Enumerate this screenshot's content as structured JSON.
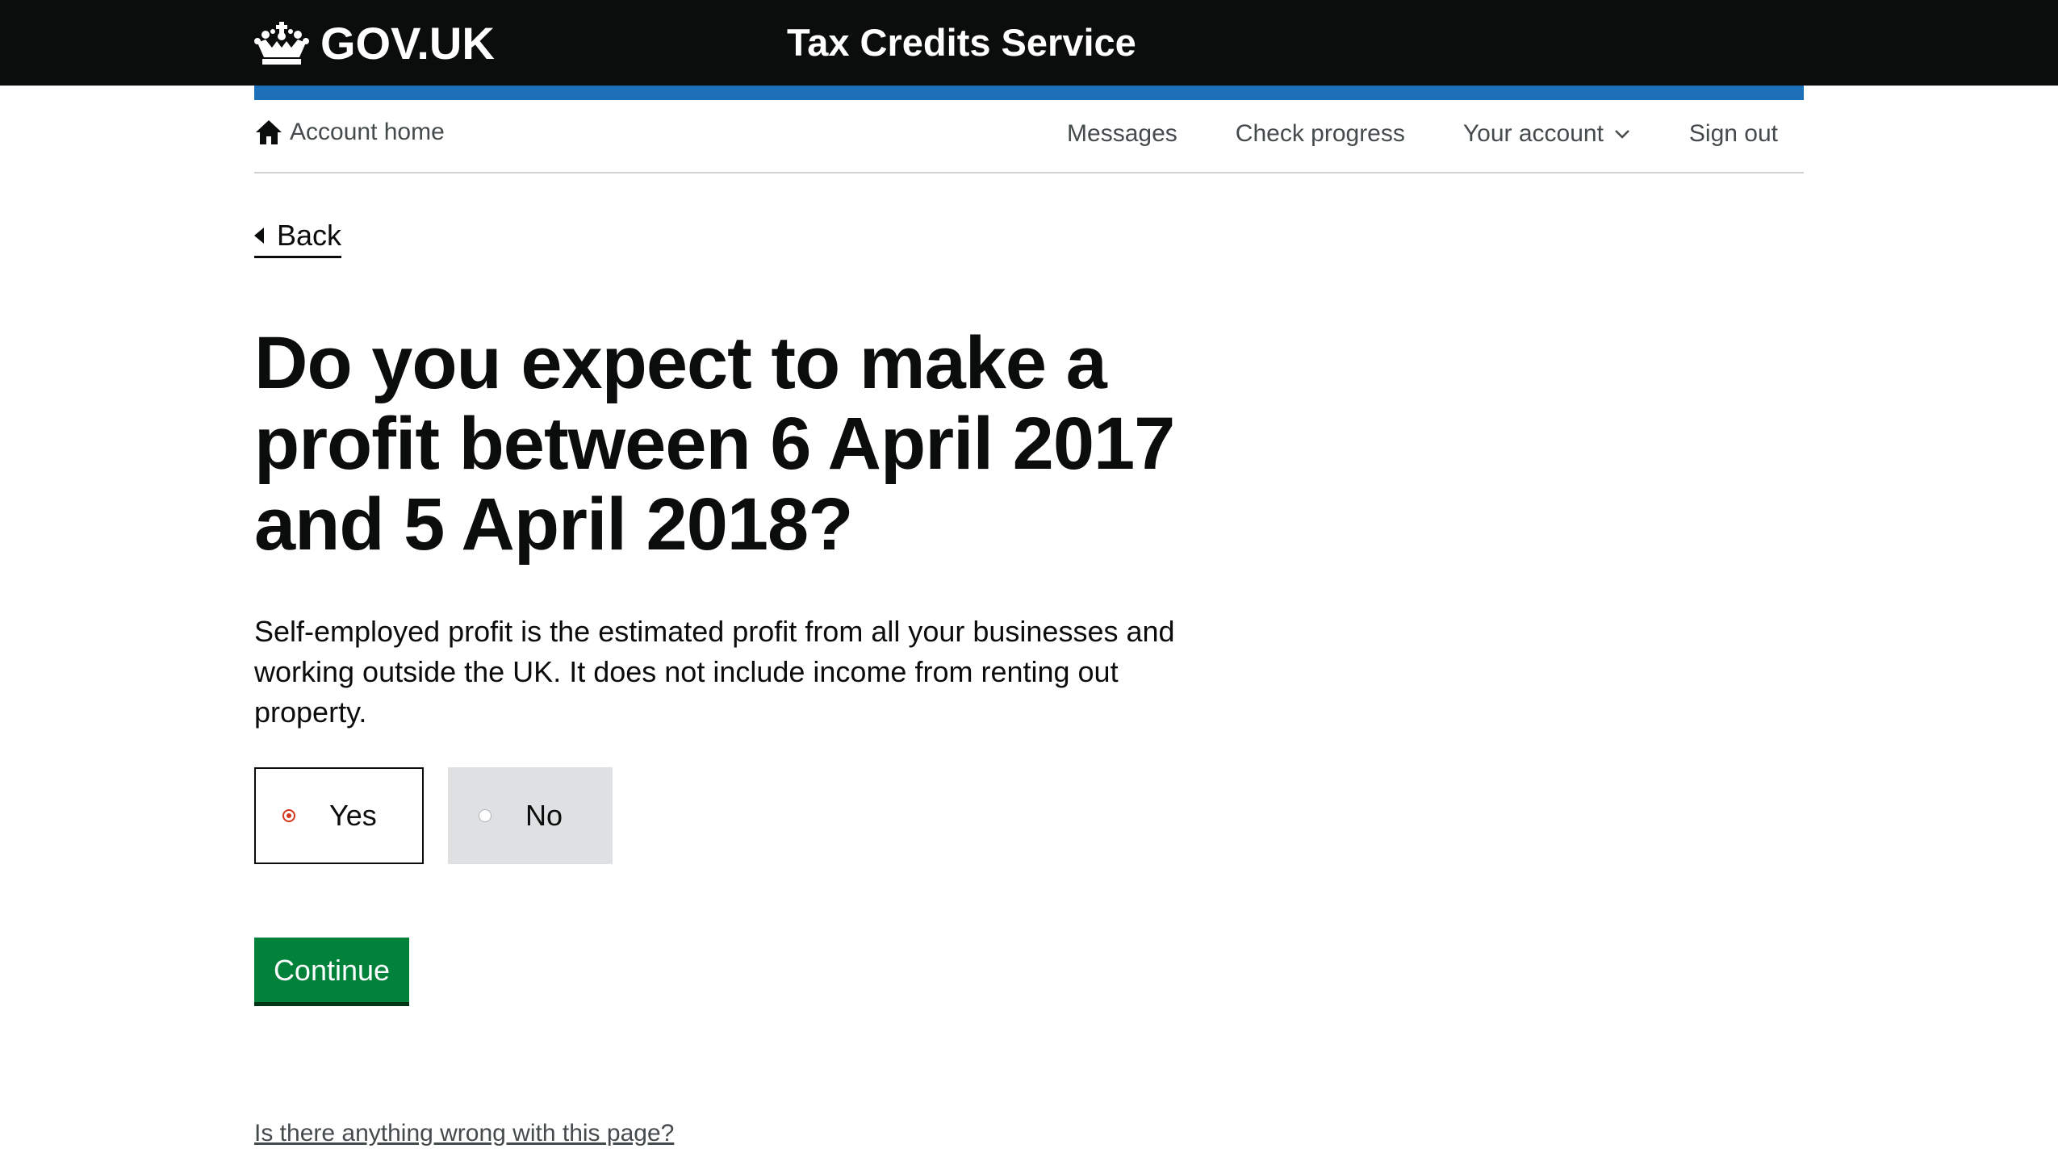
{
  "header": {
    "logo_text": "GOV.UK",
    "service_name": "Tax Credits Service",
    "accent_color": "#1d70b8"
  },
  "account_nav": {
    "home_label": "Account home",
    "links": [
      {
        "label": "Messages"
      },
      {
        "label": "Check progress"
      },
      {
        "label": "Your account"
      },
      {
        "label": "Sign out"
      }
    ]
  },
  "back_label": "Back",
  "main": {
    "heading": "Do you expect to make a profit between 6 April 2017 and 5 April 2018?",
    "hint": "Self-employed profit is the estimated profit from all your businesses and working outside the UK. It does not include income from renting out property.",
    "options": [
      {
        "label": "Yes",
        "selected": true
      },
      {
        "label": "No",
        "selected": false
      }
    ],
    "continue_label": "Continue",
    "continue_color": "#00823b"
  },
  "footer": {
    "report_link": "Is there anything wrong with this page?"
  }
}
